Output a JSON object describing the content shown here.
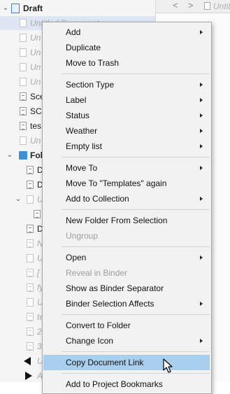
{
  "binder": {
    "draft_label": "Draft",
    "rows": [
      {
        "text": "Untitled Document"
      },
      {
        "text": "Un"
      },
      {
        "text": "Un"
      },
      {
        "text": "Un"
      },
      {
        "text": "Un"
      },
      {
        "text": "Sce"
      },
      {
        "text": "SC"
      },
      {
        "text": "tes"
      },
      {
        "text": "Un"
      },
      {
        "text": "Fol"
      },
      {
        "text": "D"
      },
      {
        "text": "D"
      },
      {
        "text": "U"
      },
      {
        "text": ""
      },
      {
        "text": "D"
      },
      {
        "text": "N"
      },
      {
        "text": "U"
      },
      {
        "text": "["
      },
      {
        "text": "fy"
      },
      {
        "text": "U"
      },
      {
        "text": "te"
      },
      {
        "text": "2"
      },
      {
        "text": "3"
      },
      {
        "text": "U"
      },
      {
        "text": "A"
      }
    ]
  },
  "editor": {
    "back_arrow": "<",
    "forward_arrow": ">",
    "title": "Untit"
  },
  "menu": {
    "items": [
      {
        "label": "Add",
        "submenu": true
      },
      {
        "label": "Duplicate"
      },
      {
        "label": "Move to Trash"
      },
      {
        "label": "Section Type",
        "submenu": true
      },
      {
        "label": "Label",
        "submenu": true
      },
      {
        "label": "Status",
        "submenu": true
      },
      {
        "label": "Weather",
        "submenu": true
      },
      {
        "label": "Empty list",
        "submenu": true
      },
      {
        "label": "Move To",
        "submenu": true
      },
      {
        "label": "Move To \"Templates\" again"
      },
      {
        "label": "Add to Collection",
        "submenu": true
      },
      {
        "label": "New Folder From Selection"
      },
      {
        "label": "Ungroup",
        "disabled": true
      },
      {
        "label": "Open",
        "submenu": true
      },
      {
        "label": "Reveal in Binder",
        "disabled": true
      },
      {
        "label": "Show as Binder Separator"
      },
      {
        "label": "Binder Selection Affects",
        "submenu": true
      },
      {
        "label": "Convert to Folder"
      },
      {
        "label": "Change Icon",
        "submenu": true
      },
      {
        "label": "Copy Document Link",
        "highlighted": true
      },
      {
        "label": "Add to Project Bookmarks"
      }
    ]
  }
}
